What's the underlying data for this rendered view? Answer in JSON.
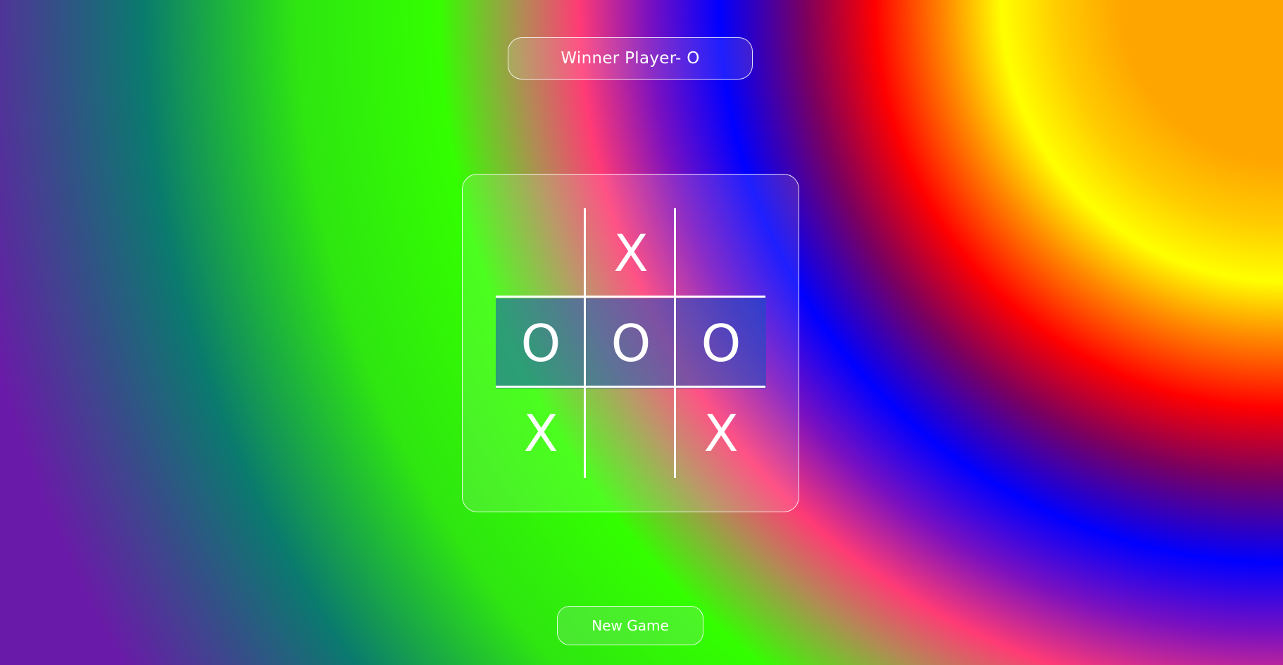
{
  "status": {
    "text": "Winner Player- O"
  },
  "board": {
    "cells": [
      {
        "mark": "",
        "winning": false
      },
      {
        "mark": "X",
        "winning": false
      },
      {
        "mark": "",
        "winning": false
      },
      {
        "mark": "O",
        "winning": true
      },
      {
        "mark": "O",
        "winning": true
      },
      {
        "mark": "O",
        "winning": true
      },
      {
        "mark": "X",
        "winning": false
      },
      {
        "mark": "",
        "winning": false
      },
      {
        "mark": "X",
        "winning": false
      }
    ]
  },
  "controls": {
    "new_game_label": "New Game"
  },
  "colors": {
    "text": "#ffffff",
    "winning_highlight": "#1450be",
    "border": "#ffffff"
  }
}
